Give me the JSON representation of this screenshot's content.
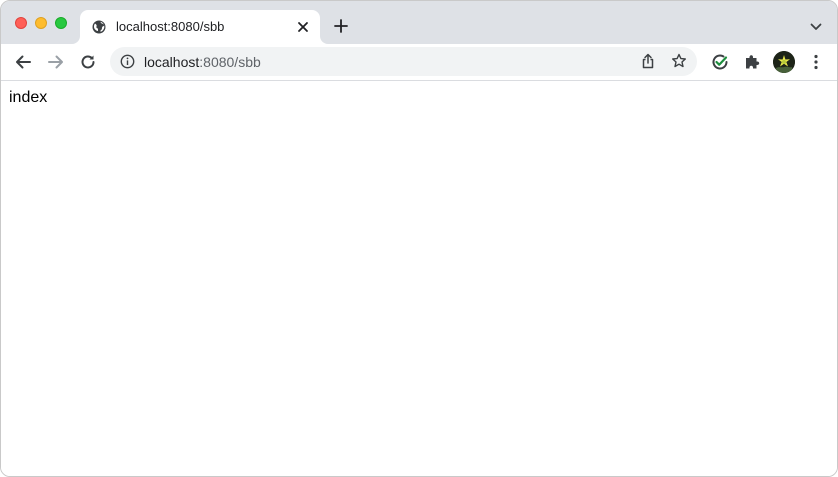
{
  "tab": {
    "title": "localhost:8080/sbb"
  },
  "omnibox": {
    "url_host": "localhost",
    "url_rest": ":8080/sbb"
  },
  "page": {
    "body_text": "index"
  },
  "icons": {
    "favicon": "globe-icon",
    "tab_close": "close-icon",
    "new_tab": "plus-icon",
    "tab_search": "chevron-down-icon",
    "back": "arrow-left-icon",
    "forward": "arrow-right-icon",
    "reload": "reload-icon",
    "site_info": "info-icon",
    "share": "share-icon",
    "bookmark": "star-icon",
    "extension_check": "check-circle-icon",
    "extensions": "puzzle-icon",
    "profile": "avatar",
    "menu": "kebab-menu-icon"
  },
  "colors": {
    "tabstrip": "#dee1e6",
    "omnibox": "#f1f3f4",
    "traffic_close": "#ff5f57",
    "traffic_min": "#febc2e",
    "traffic_max": "#28c840"
  }
}
